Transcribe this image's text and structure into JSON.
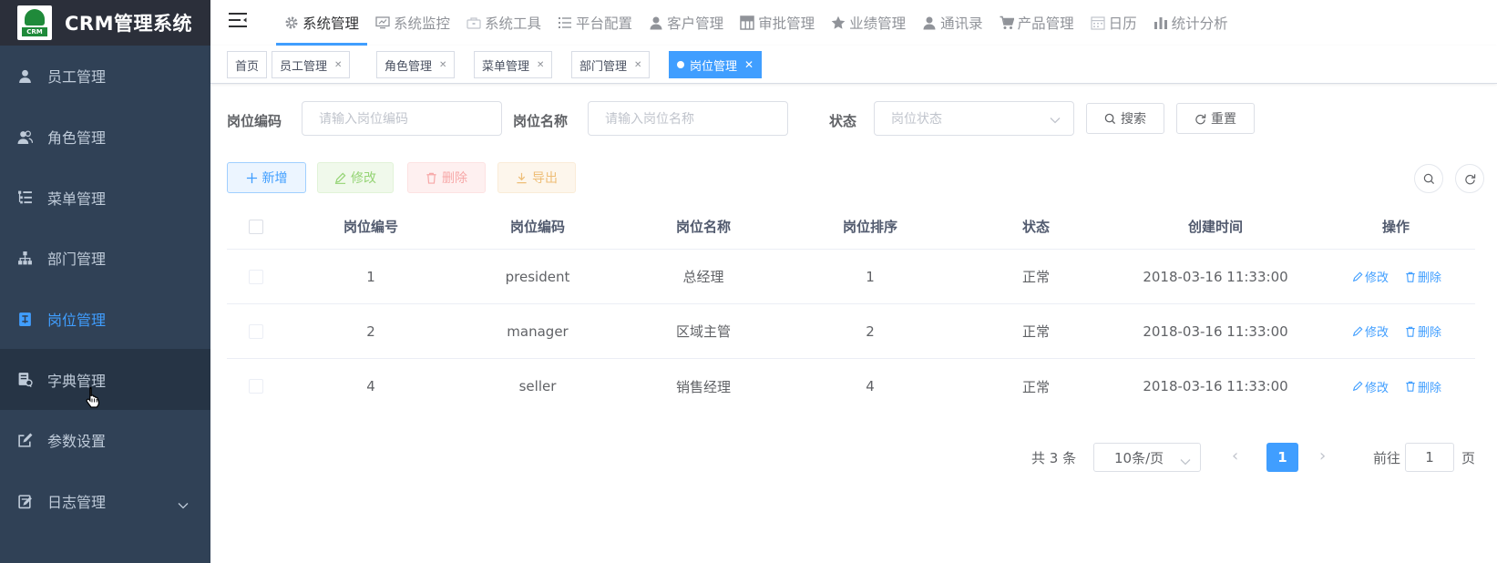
{
  "app": {
    "logo_badge": "CRM",
    "title": "CRM管理系统"
  },
  "sidebar": {
    "items": [
      {
        "label": "员工管理",
        "icon": "user-icon"
      },
      {
        "label": "角色管理",
        "icon": "peoples-icon"
      },
      {
        "label": "菜单管理",
        "icon": "tree-table-icon"
      },
      {
        "label": "部门管理",
        "icon": "tree-icon"
      },
      {
        "label": "岗位管理",
        "icon": "post-icon",
        "active": true
      },
      {
        "label": "字典管理",
        "icon": "dict-icon",
        "hovered": true
      },
      {
        "label": "参数设置",
        "icon": "edit-icon"
      },
      {
        "label": "日志管理",
        "icon": "log-icon",
        "has_submenu": true
      }
    ]
  },
  "topnav": {
    "items": [
      {
        "label": "系统管理",
        "icon": "gear-icon",
        "active": true
      },
      {
        "label": "系统监控",
        "icon": "monitor-icon"
      },
      {
        "label": "系统工具",
        "icon": "tool-icon"
      },
      {
        "label": "平台配置",
        "icon": "list-icon"
      },
      {
        "label": "客户管理",
        "icon": "user-icon"
      },
      {
        "label": "审批管理",
        "icon": "grid-icon"
      },
      {
        "label": "业绩管理",
        "icon": "star-icon"
      },
      {
        "label": "通讯录",
        "icon": "user-icon"
      },
      {
        "label": "产品管理",
        "icon": "cart-icon"
      },
      {
        "label": "日历",
        "icon": "calendar-icon"
      },
      {
        "label": "统计分析",
        "icon": "chart-icon"
      }
    ]
  },
  "tags": [
    {
      "label": "首页",
      "closable": false
    },
    {
      "label": "员工管理",
      "closable": true
    },
    {
      "label": "角色管理",
      "closable": true
    },
    {
      "label": "菜单管理",
      "closable": true
    },
    {
      "label": "部门管理",
      "closable": true
    },
    {
      "label": "岗位管理",
      "closable": true,
      "active": true
    }
  ],
  "search": {
    "post_code_label": "岗位编码",
    "post_code_placeholder": "请输入岗位编码",
    "post_name_label": "岗位名称",
    "post_name_placeholder": "请输入岗位名称",
    "status_label": "状态",
    "status_placeholder": "岗位状态",
    "search_button": "搜索",
    "reset_button": "重置"
  },
  "toolbar": {
    "add": "新增",
    "edit": "修改",
    "delete": "删除",
    "export": "导出"
  },
  "table": {
    "columns": [
      "岗位编号",
      "岗位编码",
      "岗位名称",
      "岗位排序",
      "状态",
      "创建时间",
      "操作"
    ],
    "rows": [
      {
        "id": "1",
        "code": "president",
        "name": "总经理",
        "sort": "1",
        "status": "正常",
        "created": "2018-03-16 11:33:00"
      },
      {
        "id": "2",
        "code": "manager",
        "name": "区域主管",
        "sort": "2",
        "status": "正常",
        "created": "2018-03-16 11:33:00"
      },
      {
        "id": "4",
        "code": "seller",
        "name": "销售经理",
        "sort": "4",
        "status": "正常",
        "created": "2018-03-16 11:33:00"
      }
    ],
    "row_edit": "修改",
    "row_delete": "删除"
  },
  "pagination": {
    "total": "共 3 条",
    "page_size": "10条/页",
    "current_page": "1",
    "goto_label": "前往",
    "goto_value": "1",
    "page_suffix": "页"
  },
  "colors": {
    "sidebar_bg": "#304156",
    "logo_bg": "#2b2f3a",
    "accent": "#409eff",
    "sidebar_text": "#bfcbd9"
  }
}
